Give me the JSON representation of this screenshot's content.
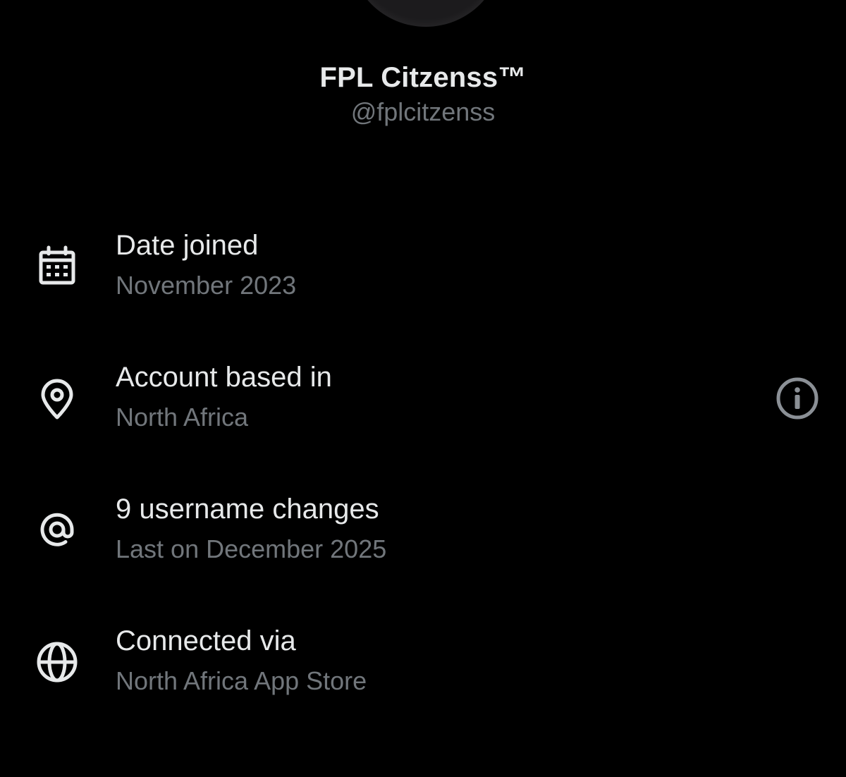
{
  "profile": {
    "name": "FPL Citzenss™",
    "handle": "@fplcitzenss"
  },
  "rows": [
    {
      "title": "Date joined",
      "subtitle": "November 2023",
      "icon": "calendar-icon"
    },
    {
      "title": "Account based in",
      "subtitle": "North Africa",
      "icon": "location-pin-icon",
      "action_icon": "info-icon"
    },
    {
      "title": "9 username changes",
      "subtitle": "Last on December 2025",
      "icon": "at-sign-icon"
    },
    {
      "title": "Connected via",
      "subtitle": "North Africa App Store",
      "icon": "globe-icon"
    }
  ],
  "colors": {
    "background": "#000000",
    "primary_text": "#e7e9ea",
    "secondary_text": "#71767b",
    "icon": "#e7e9ea",
    "info_icon": "#8b9096"
  }
}
